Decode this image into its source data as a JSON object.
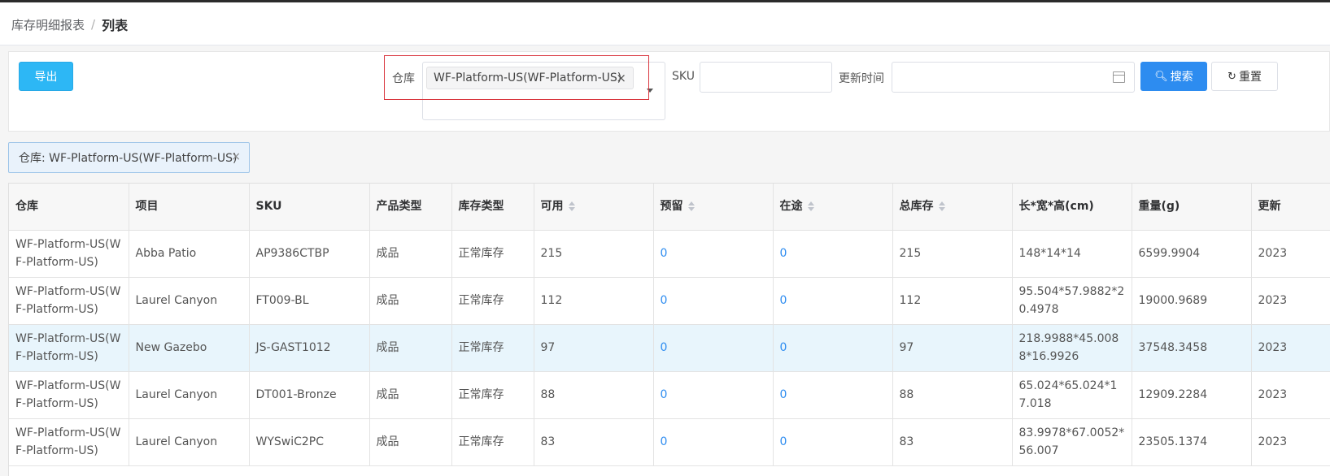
{
  "breadcrumb": {
    "parent": "库存明细报表",
    "separator": "/",
    "current": "列表"
  },
  "toolbar": {
    "export_label": "导出"
  },
  "filters": {
    "warehouse_label": "仓库",
    "warehouse_tag": "WF-Platform-US(WF-Platform-US)",
    "warehouse_tag_close": "×",
    "sku_label": "SKU",
    "sku_value": "",
    "update_time_label": "更新时间",
    "update_time_value": "",
    "search_label": "搜索",
    "reset_label": "重置"
  },
  "active_filter": {
    "text": "仓库: WF-Platform-US(WF-Platform-US)",
    "close": "×"
  },
  "colors": {
    "primary": "#2d8cf0",
    "export": "#2db7f5",
    "highlight_border": "#d9363e",
    "row_highlight": "#e8f5fc"
  },
  "icons": {
    "search": "search-icon",
    "reset": "refresh-icon",
    "calendar": "calendar-icon",
    "sort": "sort-icon"
  },
  "table": {
    "headers": [
      "仓库",
      "项目",
      "SKU",
      "产品类型",
      "库存类型",
      "可用",
      "预留",
      "在途",
      "总库存",
      "长*宽*高(cm)",
      "重量(g)",
      "更新"
    ],
    "rows": [
      [
        "WF-Platform-US(WF-Platform-US)",
        "Abba Patio",
        "AP9386CTBP",
        "成品",
        "正常库存",
        "215",
        "0",
        "0",
        "215",
        "148*14*14",
        "6599.9904",
        "2023"
      ],
      [
        "WF-Platform-US(WF-Platform-US)",
        "Laurel Canyon",
        "FT009-BL",
        "成品",
        "正常库存",
        "112",
        "0",
        "0",
        "112",
        "95.504*57.9882*20.4978",
        "19000.9689",
        "2023"
      ],
      [
        "WF-Platform-US(WF-Platform-US)",
        "New Gazebo",
        "JS-GAST1012",
        "成品",
        "正常库存",
        "97",
        "0",
        "0",
        "97",
        "218.9988*45.0088*16.9926",
        "37548.3458",
        "2023"
      ],
      [
        "WF-Platform-US(WF-Platform-US)",
        "Laurel Canyon",
        "DT001-Bronze",
        "成品",
        "正常库存",
        "88",
        "0",
        "0",
        "88",
        "65.024*65.024*17.018",
        "12909.2284",
        "2023"
      ],
      [
        "WF-Platform-US(WF-Platform-US)",
        "Laurel Canyon",
        "WYSwiC2PC",
        "成品",
        "正常库存",
        "83",
        "0",
        "0",
        "83",
        "83.9978*67.0052*56.007",
        "23505.1374",
        "2023"
      ]
    ]
  }
}
